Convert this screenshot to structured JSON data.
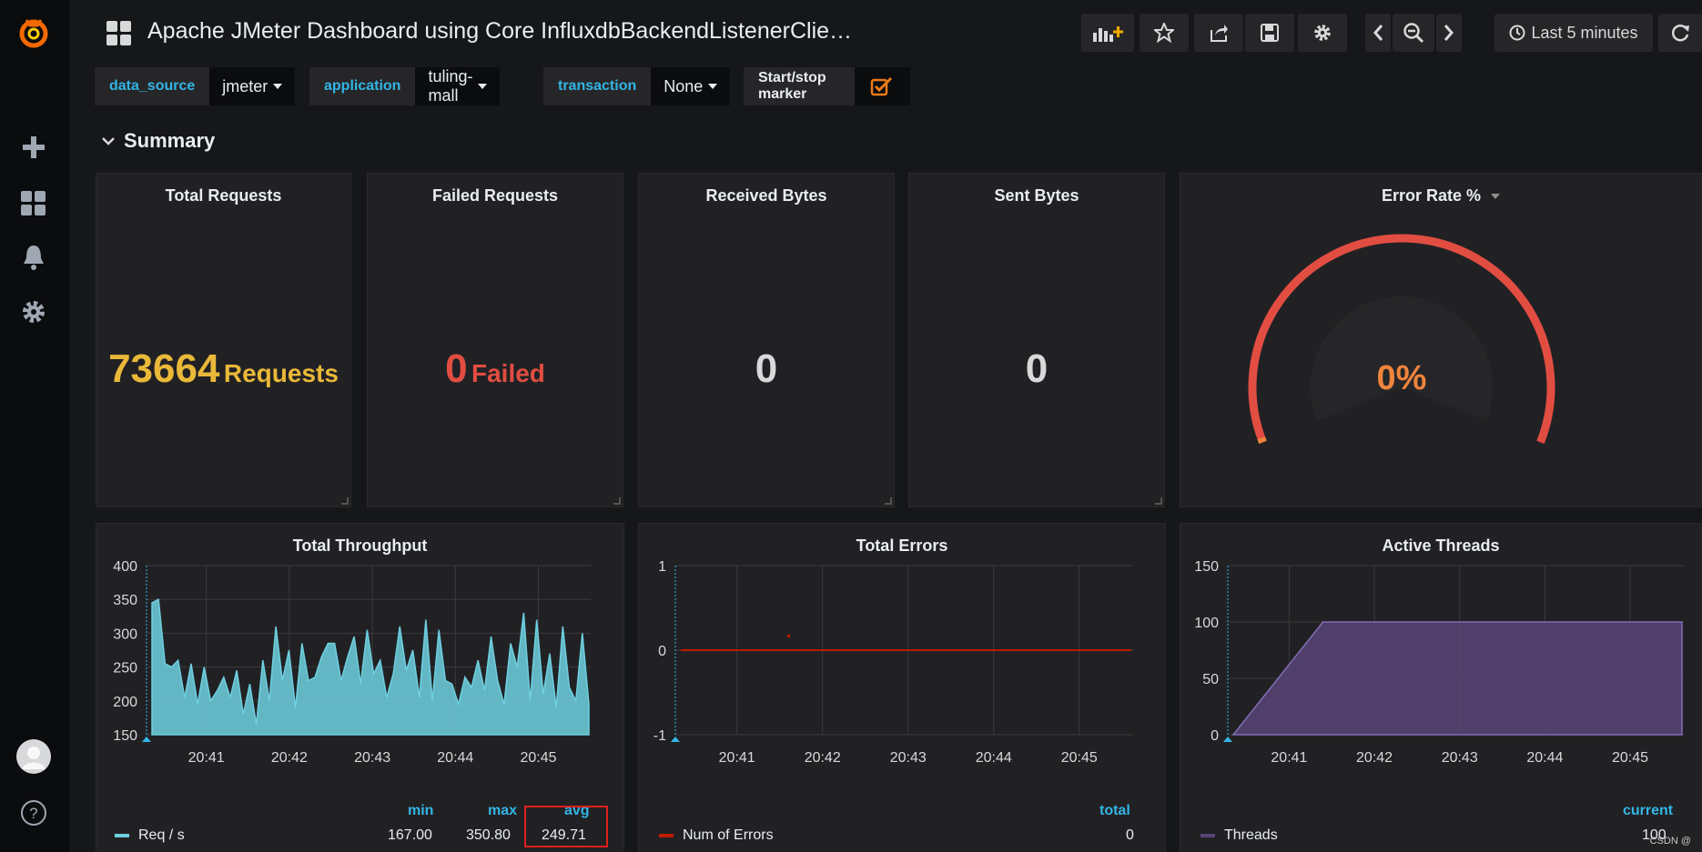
{
  "dashboard": {
    "title": "Apache JMeter Dashboard using Core InfluxdbBackendListenerClie…",
    "time_range": "Last 5 minutes"
  },
  "variables": [
    {
      "label": "data_source",
      "value": "jmeter"
    },
    {
      "label": "application",
      "value": "tuling-mall"
    },
    {
      "label": "transaction",
      "value": "None"
    },
    {
      "label": "Start/stop marker",
      "value": ""
    }
  ],
  "row": {
    "title": "Summary"
  },
  "stats": {
    "total_requests": {
      "title": "Total Requests",
      "value": "73664",
      "unit": "Requests",
      "color": "#eab839"
    },
    "failed_requests": {
      "title": "Failed Requests",
      "value": "0",
      "unit": "Failed",
      "color": "#e24d42"
    },
    "received_bytes": {
      "title": "Received Bytes",
      "value": "0"
    },
    "sent_bytes": {
      "title": "Sent Bytes",
      "value": "0"
    }
  },
  "gauge": {
    "title": "Error Rate %",
    "value": "0%",
    "level": 0,
    "color": "#e24d42",
    "value_color": "#ef843c"
  },
  "chart_data": [
    {
      "type": "area",
      "title": "Total Throughput",
      "x": [
        "20:41",
        "20:42",
        "20:43",
        "20:44",
        "20:45"
      ],
      "ylim": [
        150,
        400
      ],
      "yticks": [
        "400",
        "350",
        "300",
        "250",
        "200",
        "150"
      ],
      "series": [
        {
          "name": "Req / s",
          "color": "#6ed0e0",
          "values": [
            345,
            350,
            255,
            250,
            260,
            205,
            255,
            195,
            250,
            200,
            215,
            235,
            205,
            245,
            180,
            225,
            165,
            260,
            200,
            310,
            230,
            275,
            190,
            285,
            230,
            235,
            265,
            285,
            285,
            230,
            265,
            295,
            225,
            305,
            240,
            260,
            205,
            240,
            310,
            245,
            275,
            205,
            320,
            200,
            305,
            230,
            225,
            195,
            235,
            220,
            260,
            215,
            295,
            230,
            195,
            285,
            250,
            330,
            200,
            320,
            210,
            270,
            190,
            310,
            220,
            200,
            300,
            195
          ]
        }
      ],
      "legend": {
        "headers": [
          "min",
          "max",
          "avg"
        ],
        "values": [
          "167.00",
          "350.80",
          "249.71"
        ]
      }
    },
    {
      "type": "line",
      "title": "Total Errors",
      "x": [
        "20:41",
        "20:42",
        "20:43",
        "20:44",
        "20:45"
      ],
      "ylim": [
        -1,
        1
      ],
      "yticks": [
        "1",
        "0",
        "-1"
      ],
      "series": [
        {
          "name": "Num of Errors",
          "color": "#bf1b00",
          "values": [
            0,
            0,
            0,
            0,
            0
          ]
        }
      ],
      "legend": {
        "headers": [
          "total"
        ],
        "values": [
          "0"
        ]
      }
    },
    {
      "type": "area",
      "title": "Active Threads",
      "x": [
        "20:41",
        "20:42",
        "20:43",
        "20:44",
        "20:45"
      ],
      "ylim": [
        0,
        150
      ],
      "yticks": [
        "150",
        "100",
        "50",
        "0"
      ],
      "series": [
        {
          "name": "Threads",
          "color": "#584477",
          "values": [
            0,
            100,
            100,
            100,
            100,
            100
          ]
        }
      ],
      "legend": {
        "headers": [
          "current"
        ],
        "values": [
          "100"
        ]
      }
    }
  ],
  "watermark": "CSDN @"
}
